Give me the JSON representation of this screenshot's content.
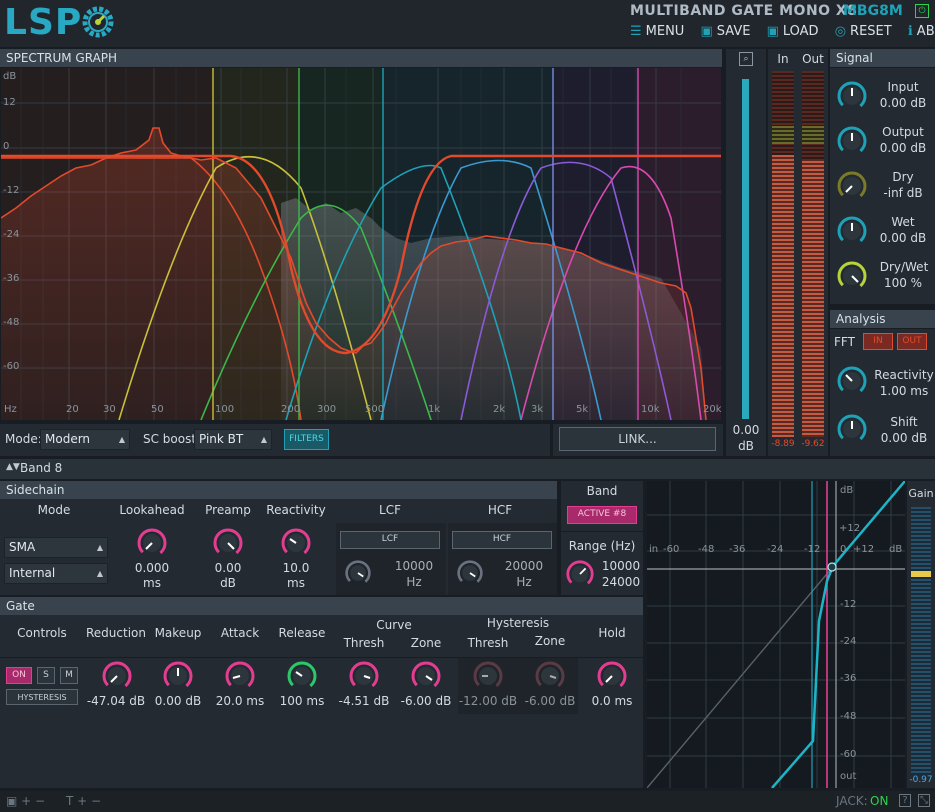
{
  "app": {
    "logo": "LSP",
    "plugin_title": "MULTIBAND GATE MONO X8",
    "plugin_code": "MBG8M"
  },
  "menu": {
    "menu": "MENU",
    "save": "SAVE",
    "load": "LOAD",
    "reset": "RESET",
    "about": "ABOUT"
  },
  "spectrum": {
    "title": "SPECTRUM GRAPH",
    "db_labels": [
      "dB",
      "12",
      "0",
      "-12",
      "-24",
      "-36",
      "-48",
      "-60"
    ],
    "freq_labels": [
      "Hz",
      "20",
      "30",
      "50",
      "100",
      "200",
      "300",
      "500",
      "1k",
      "2k",
      "3k",
      "5k",
      "10k",
      "20k"
    ]
  },
  "meters": {
    "zoom_value": "0.00",
    "zoom_unit": "dB",
    "in_label": "In",
    "out_label": "Out",
    "in_value": "-8.89",
    "out_value": "-9.62"
  },
  "signal": {
    "title": "Signal",
    "input_label": "Input",
    "input_value": "0.00 dB",
    "output_label": "Output",
    "output_value": "0.00 dB",
    "dry_label": "Dry",
    "dry_value": "-inf dB",
    "wet_label": "Wet",
    "wet_value": "0.00 dB",
    "drywet_label": "Dry/Wet",
    "drywet_value": "100 %"
  },
  "analysis": {
    "title": "Analysis",
    "fft_label": "FFT",
    "in_btn": "IN",
    "out_btn": "OUT",
    "reactivity_label": "Reactivity",
    "reactivity_value": "1.00 ms",
    "shift_label": "Shift",
    "shift_value": "0.00 dB"
  },
  "controls_bar": {
    "mode_label": "Mode:",
    "mode_value": "Modern",
    "scboost_label": "SC boost:",
    "scboost_value": "Pink BT",
    "filters_btn": "FILTERS",
    "link_btn": "LINK..."
  },
  "band": {
    "title": "Band 8"
  },
  "sidechain": {
    "title": "Sidechain",
    "mode_label": "Mode",
    "lookahead_label": "Lookahead",
    "preamp_label": "Preamp",
    "reactivity_label": "Reactivity",
    "lcf_label": "LCF",
    "hcf_label": "HCF",
    "mode_value_1": "SMA",
    "mode_value_2": "Internal",
    "lookahead_value": "0.000",
    "lookahead_unit": "ms",
    "preamp_value": "0.00",
    "preamp_unit": "dB",
    "reactivity_value": "10.0",
    "reactivity_unit": "ms",
    "lcf_btn": "LCF",
    "hcf_btn": "HCF",
    "lcf_value": "10000",
    "lcf_unit": "Hz",
    "hcf_value": "20000",
    "hcf_unit": "Hz"
  },
  "band_box": {
    "label": "Band",
    "active_btn": "ACTIVE #8",
    "range_label": "Range (Hz)",
    "range_low": "10000",
    "range_high": "24000"
  },
  "gate": {
    "title": "Gate",
    "controls_label": "Controls",
    "reduction_label": "Reduction",
    "makeup_label": "Makeup",
    "attack_label": "Attack",
    "release_label": "Release",
    "curve_label": "Curve",
    "hysteresis_label": "Hysteresis",
    "thresh_label": "Thresh",
    "zone_label": "Zone",
    "hyst_thresh_label": "Thresh",
    "hyst_zone_label": "Zone",
    "hold_label": "Hold",
    "on_btn": "ON",
    "s_btn": "S",
    "m_btn": "M",
    "hysteresis_btn": "HYSTERESIS",
    "reduction_value": "-47.04 dB",
    "makeup_value": "0.00 dB",
    "attack_value": "20.0 ms",
    "release_value": "100 ms",
    "thresh_value": "-4.51 dB",
    "zone_value": "-6.00 dB",
    "hyst_thresh_value": "-12.00 dB",
    "hyst_zone_value": "-6.00 dB",
    "hold_value": "0.0 ms"
  },
  "curve": {
    "top_db": "dB",
    "plus12": "+12",
    "in_label": "in",
    "x_labels": [
      "-60",
      "-48",
      "-36",
      "-24",
      "-12",
      "0",
      "+12",
      "dB"
    ],
    "y_labels": [
      "-12",
      "-24",
      "-36",
      "-48",
      "-60"
    ],
    "out_label": "out"
  },
  "gain": {
    "label": "Gain",
    "value": "-0.97"
  },
  "status": {
    "jack_label": "JACK:",
    "jack_value": "ON"
  },
  "colors": {
    "accent": "#1ea2b8",
    "pink": "#e33d91",
    "red": "#e34a2c",
    "panel": "#232a31",
    "header": "#39434d"
  }
}
